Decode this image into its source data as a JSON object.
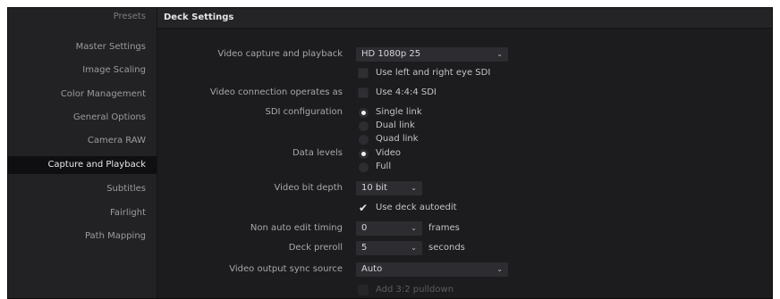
{
  "sidebar": {
    "items": [
      {
        "label": "Presets"
      },
      {
        "label": "Master Settings"
      },
      {
        "label": "Image Scaling"
      },
      {
        "label": "Color Management"
      },
      {
        "label": "General Options"
      },
      {
        "label": "Camera RAW"
      },
      {
        "label": "Capture and Playback",
        "active": true
      },
      {
        "label": "Subtitles"
      },
      {
        "label": "Fairlight"
      },
      {
        "label": "Path Mapping"
      }
    ]
  },
  "header": {
    "title": "Deck Settings"
  },
  "settings": {
    "video_capture_label": "Video capture and playback",
    "video_capture_value": "HD 1080p 25",
    "eye_sdi_label": "Use left and right eye SDI",
    "connection_label": "Video connection operates as",
    "connection_option": "Use 4:4:4 SDI",
    "sdi_label": "SDI configuration",
    "sdi_options": [
      "Single link",
      "Dual link",
      "Quad link"
    ],
    "sdi_selected": "Single link",
    "data_levels_label": "Data levels",
    "data_levels_options": [
      "Video",
      "Full"
    ],
    "data_levels_selected": "Video",
    "bit_depth_label": "Video bit depth",
    "bit_depth_value": "10 bit",
    "autoedit_label": "Use deck autoedit",
    "autoedit_checked": true,
    "non_auto_label": "Non auto edit timing",
    "non_auto_value": "0",
    "non_auto_unit": "frames",
    "preroll_label": "Deck preroll",
    "preroll_value": "5",
    "preroll_unit": "seconds",
    "sync_label": "Video output sync source",
    "sync_value": "Auto",
    "pulldown_label": "Add 3:2 pulldown"
  },
  "icons": {
    "chevron": "chevron-down-icon",
    "check": "checkmark-icon"
  },
  "colors": {
    "background": "#1c1c1e",
    "sidebar": "#222225",
    "active": "#0f0f11",
    "field": "#2d2d31"
  }
}
